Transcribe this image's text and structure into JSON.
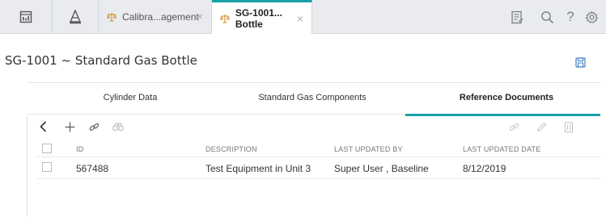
{
  "tabs": {
    "tab1_label": "Calibra...agement",
    "tab2_label": "SG-1001... Bottle",
    "close_glyph": "×",
    "help_glyph": "?"
  },
  "page": {
    "title": "SG-1001 ~ Standard Gas Bottle"
  },
  "section_tabs": {
    "cylinder": "Cylinder Data",
    "components": "Standard Gas Components",
    "references": "Reference Documents",
    "active": "references"
  },
  "grid": {
    "columns": {
      "id": "ID",
      "description": "DESCRIPTION",
      "updated_by": "LAST UPDATED BY",
      "updated_date": "LAST UPDATED DATE"
    },
    "rows": [
      {
        "id": "567488",
        "description": "Test Equipment in Unit 3",
        "updated_by": "Super User , Baseline",
        "updated_date": "8/12/2019"
      }
    ]
  },
  "icons": {
    "toolbar": [
      "back-icon",
      "add-icon",
      "link-icon",
      "binoculars-icon",
      "unlink-icon",
      "edit-icon",
      "delete-icon"
    ],
    "header": [
      "dashboard-icon",
      "assets-icon",
      "scale-icon",
      "report-icon",
      "search-icon",
      "help-icon",
      "settings-icon",
      "save-icon"
    ]
  },
  "colors": {
    "accent": "#16a0a8",
    "tabbar_bg": "#e9ebee"
  }
}
